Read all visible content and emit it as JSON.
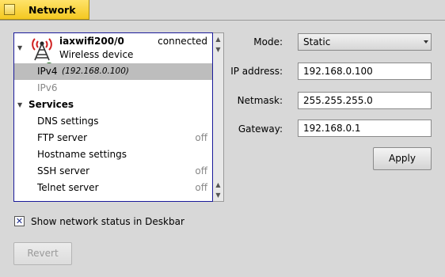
{
  "window": {
    "title": "Network"
  },
  "device": {
    "name": "iaxwifi200/0",
    "type": "Wireless device",
    "status": "connected",
    "ipv4_label": "IPv4",
    "ipv4_address": "(192.168.0.100)",
    "ipv6_label": "IPv6"
  },
  "services": {
    "heading": "Services",
    "items": [
      {
        "label": "DNS settings",
        "state": ""
      },
      {
        "label": "FTP server",
        "state": "off"
      },
      {
        "label": "Hostname settings",
        "state": ""
      },
      {
        "label": "SSH server",
        "state": "off"
      },
      {
        "label": "Telnet server",
        "state": "off"
      }
    ]
  },
  "form": {
    "mode_label": "Mode:",
    "mode_value": "Static",
    "ip_label": "IP address:",
    "ip_value": "192.168.0.100",
    "netmask_label": "Netmask:",
    "netmask_value": "255.255.255.0",
    "gateway_label": "Gateway:",
    "gateway_value": "192.168.0.1",
    "apply_label": "Apply"
  },
  "options": {
    "show_status_label": "Show network status in Deskbar",
    "show_status_checked": true
  },
  "footer": {
    "revert_label": "Revert"
  },
  "icons": {
    "tab_close": "close-box-icon",
    "device": "wifi-tower-icon",
    "status": "green-status-dot-icon",
    "expand": "triangle-down-icon",
    "scroll_up": "arrow-up-icon",
    "scroll_down": "arrow-down-icon",
    "dropdown": "chevron-down-icon",
    "check": "check-mark-icon"
  },
  "colors": {
    "tab": "#f4c820",
    "selection": "#bdbdbd",
    "focus_border": "#1a1a9a"
  }
}
